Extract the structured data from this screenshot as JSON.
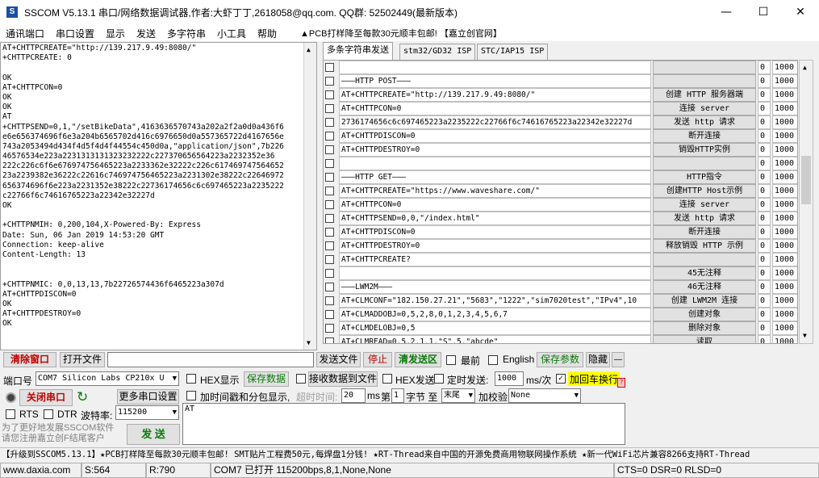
{
  "window": {
    "title": "SSCOM V5.13.1 串口/网络数据调试器,作者:大虾丁丁,2618058@qq.com. QQ群: 52502449(最新版本)",
    "minimize": "—",
    "maximize": "☐",
    "close": "✕"
  },
  "menu": {
    "items": [
      "通讯端口",
      "串口设置",
      "显示",
      "发送",
      "多字符串",
      "小工具",
      "帮助"
    ],
    "ad": "▲PCB打样降至每款30元顺丰包邮!  【嘉立创官网】"
  },
  "receive": {
    "lines": [
      "AT+CHTTPCREATE=\"http://139.217.9.49:8080/\"",
      "+CHTTPCREATE: 0",
      "",
      "OK",
      "AT+CHTTPCON=0",
      "OK",
      "OK",
      "AT",
      "+CHTTPSEND=0,1,\"/setBikeData\",4163636570743a202a2f2a0d0a436f6",
      "e6e656374696f6e3a204b6565702d416c6976650d0a557365722d4167656e",
      "743a2053494d434f4d5f4d4f44554c450d0a,\"application/json\",7b226",
      "46576534e223a2231313131323232222c227370656564223a2232352e36",
      "222c226c6f6e676974756465223a2233362e32222c226c617469747564652",
      "23a2239382e36222c22616c746974756465223a2231302e38222c22646972",
      "656374696f6e223a2231352e38222c22736174656c6c697465223a2235222",
      "c22766f6c74616765223a22342e32227d",
      "OK",
      "",
      "+CHTTPNMIH: 0,200,104,X-Powered-By: Express",
      "Date: Sun, 06 Jan 2019 14:53:20 GMT",
      "Connection: keep-alive",
      "Content-Length: 13",
      "",
      "",
      "+CHTTPNMIC: 0,0,13,13,7b22726574436f6465223a307d",
      "AT+CHTTPDISCON=0",
      "OK",
      "AT+CHTTPDESTROY=0",
      "OK"
    ]
  },
  "tabs": [
    "多条字符串发送",
    "stm32/GD32 ISP",
    "STC/IAP15 ISP"
  ],
  "rows": [
    {
      "cmd": "",
      "btn": "",
      "n0": "0",
      "n1": "1000"
    },
    {
      "cmd": "———HTTP POST———",
      "btn": "",
      "n0": "0",
      "n1": "1000"
    },
    {
      "cmd": "AT+CHTTPCREATE=\"http://139.217.9.49:8080/\"",
      "btn": "创建 HTTP 服务器端",
      "n0": "0",
      "n1": "1000"
    },
    {
      "cmd": "AT+CHTTPCON=0",
      "btn": "连接 server",
      "n0": "0",
      "n1": "1000"
    },
    {
      "cmd": "2736174656c6c697465223a2235222c22766f6c74616765223a22342e32227d",
      "btn": "发送 http 请求",
      "n0": "0",
      "n1": "1000"
    },
    {
      "cmd": "AT+CHTTPDISCON=0",
      "btn": "断开连接",
      "n0": "0",
      "n1": "1000"
    },
    {
      "cmd": "AT+CHTTPDESTROY=0",
      "btn": "销毁HTTP实例",
      "n0": "0",
      "n1": "1000"
    },
    {
      "cmd": "",
      "btn": "",
      "n0": "0",
      "n1": "1000"
    },
    {
      "cmd": "———HTTP GET———",
      "btn": "HTTP指令",
      "n0": "0",
      "n1": "1000"
    },
    {
      "cmd": "AT+CHTTPCREATE=\"https://www.waveshare.com/\"",
      "btn": "创建HTTP Host示例",
      "n0": "0",
      "n1": "1000"
    },
    {
      "cmd": "AT+CHTTPCON=0",
      "btn": "连接 server",
      "n0": "0",
      "n1": "1000"
    },
    {
      "cmd": "AT+CHTTPSEND=0,0,\"/index.html\"",
      "btn": "发送 http 请求",
      "n0": "0",
      "n1": "1000"
    },
    {
      "cmd": "AT+CHTTPDISCON=0",
      "btn": "断开连接",
      "n0": "0",
      "n1": "1000"
    },
    {
      "cmd": "AT+CHTTPDESTROY=0",
      "btn": "释放销毁 HTTP 示例",
      "n0": "0",
      "n1": "1000"
    },
    {
      "cmd": "AT+CHTTPCREATE?",
      "btn": "",
      "n0": "0",
      "n1": "1000"
    },
    {
      "cmd": "",
      "btn": "45无注释",
      "n0": "0",
      "n1": "1000"
    },
    {
      "cmd": "———LWM2M———",
      "btn": "46无注释",
      "n0": "0",
      "n1": "1000"
    },
    {
      "cmd": "AT+CLMCONF=\"182.150.27.21\",\"5683\",\"1222\",\"sim7020test\",\"IPv4\",10",
      "btn": "创建 LWM2M 连接",
      "n0": "0",
      "n1": "1000"
    },
    {
      "cmd": "AT+CLMADDOBJ=0,5,2,8,0,1,2,3,4,5,6,7",
      "btn": "创建对象",
      "n0": "0",
      "n1": "1000"
    },
    {
      "cmd": "AT+CLMDELOBJ=0,5",
      "btn": "删除对象",
      "n0": "0",
      "n1": "1000"
    },
    {
      "cmd": "AT+CLMREAD=0,5,2,1,1,\"S\",5,\"abcde\"",
      "btn": "读取",
      "n0": "0",
      "n1": "1000"
    }
  ],
  "controls": {
    "clear_window": "清除窗口",
    "open_file": "打开文件",
    "send_file": "发送文件",
    "stop": "停止",
    "clear_send": "清发送区",
    "topmost": "最前",
    "english": "English",
    "save_params": "保存参数",
    "expand": "隐藏",
    "minus": "—",
    "port_label": "端口号",
    "port_value": "COM7 Silicon Labs CP210x U",
    "hex_display": "HEX显示",
    "save_data": "保存数据",
    "recv_to_file": "接收数据到文件",
    "hex_send": "HEX发送",
    "timed_send": "定时发送:",
    "interval": "1000",
    "interval_unit": "ms/次",
    "crlf": "加回车换行",
    "close_port": "关闭串口",
    "more_settings": "更多串口设置",
    "timestamp": "加时间戳和分包显示,",
    "timeout_label": "超时时间:",
    "timeout_value": "20",
    "ms": "ms",
    "nth_label": "第",
    "nth_value": "1",
    "byte_label": "字节 至",
    "end_value": "末尾",
    "checksum_label": "加校验",
    "checksum_value": "None",
    "rts": "RTS",
    "dtr": "DTR",
    "baud_label": "波特率:",
    "baud_value": "115200",
    "promo": "为了更好地发展SSCOM软件\n请您注册嘉立创F结尾客户",
    "send": "发 送",
    "send_text": "AT"
  },
  "ticker": "【升级到SSCOM5.13.1】★PCB打样降至每款30元顺丰包邮! SMT贴片工程费50元,每焊盘1分钱! ★RT-Thread来自中国的开源免费商用物联网操作系统 ★新一代WiFi芯片兼容8266支持RT-Thread",
  "statusbar": {
    "site": "www.daxia.com",
    "sent": "S:564",
    "recv": "R:790",
    "port": "COM7 已打开  115200bps,8,1,None,None",
    "lines": "CTS=0 DSR=0 RLSD=0"
  }
}
